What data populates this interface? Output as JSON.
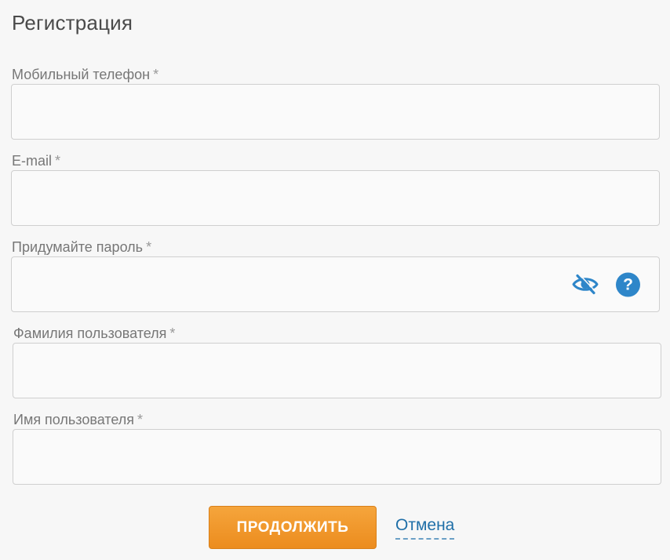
{
  "form": {
    "title": "Регистрация",
    "required_mark": "*",
    "fields": [
      {
        "label": "Мобильный телефон",
        "value": "",
        "placeholder": ""
      },
      {
        "label": "E-mail",
        "value": "",
        "placeholder": ""
      },
      {
        "label": "Придумайте пароль",
        "value": "",
        "placeholder": ""
      },
      {
        "label": "Фамилия пользователя",
        "value": "",
        "placeholder": ""
      },
      {
        "label": "Имя пользователя",
        "value": "",
        "placeholder": ""
      }
    ],
    "password_help": "?",
    "continue_label": "ПРОДОЛЖИТЬ",
    "cancel_label": "Отмена"
  },
  "colors": {
    "accent_orange": "#ec8c1e",
    "link_blue": "#1f6fa8",
    "icon_blue": "#2e86c9"
  },
  "icons": {
    "password_visibility": "eye-slash-icon",
    "password_help": "question-circle-icon"
  }
}
